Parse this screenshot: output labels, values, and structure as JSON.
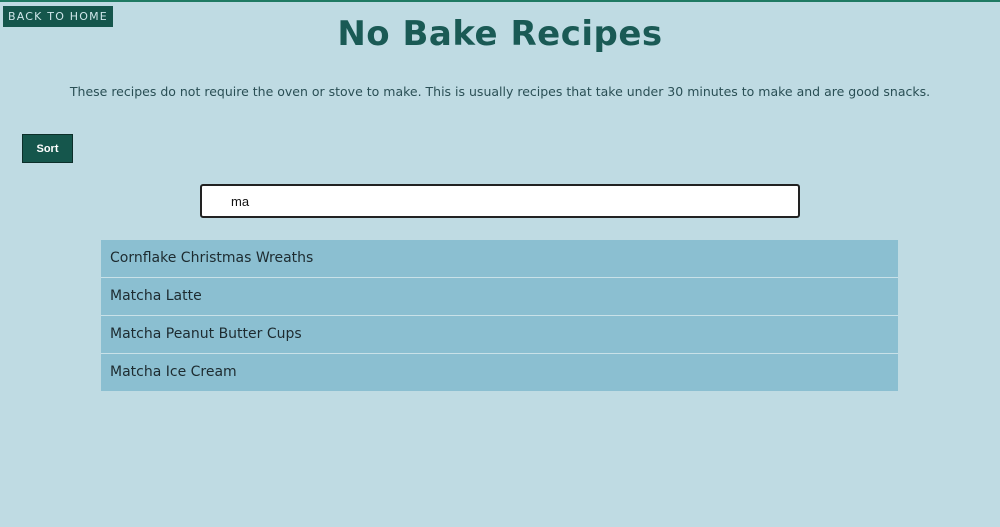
{
  "nav": {
    "back_label": "BACK TO HOME"
  },
  "header": {
    "title": "No Bake Recipes",
    "subtitle": "These recipes do not require the oven or stove to make. This is usually recipes that take under 30 minutes to make and are good snacks."
  },
  "controls": {
    "sort_label": "Sort"
  },
  "search": {
    "value": "ma"
  },
  "results": [
    "Cornflake Christmas Wreaths",
    "Matcha Latte",
    "Matcha Peanut Butter Cups",
    "Matcha Ice Cream"
  ],
  "colors": {
    "background": "#bfdbe3",
    "accent": "#15564c",
    "title": "#1a5a55",
    "list_item": "#8bbfd1"
  }
}
